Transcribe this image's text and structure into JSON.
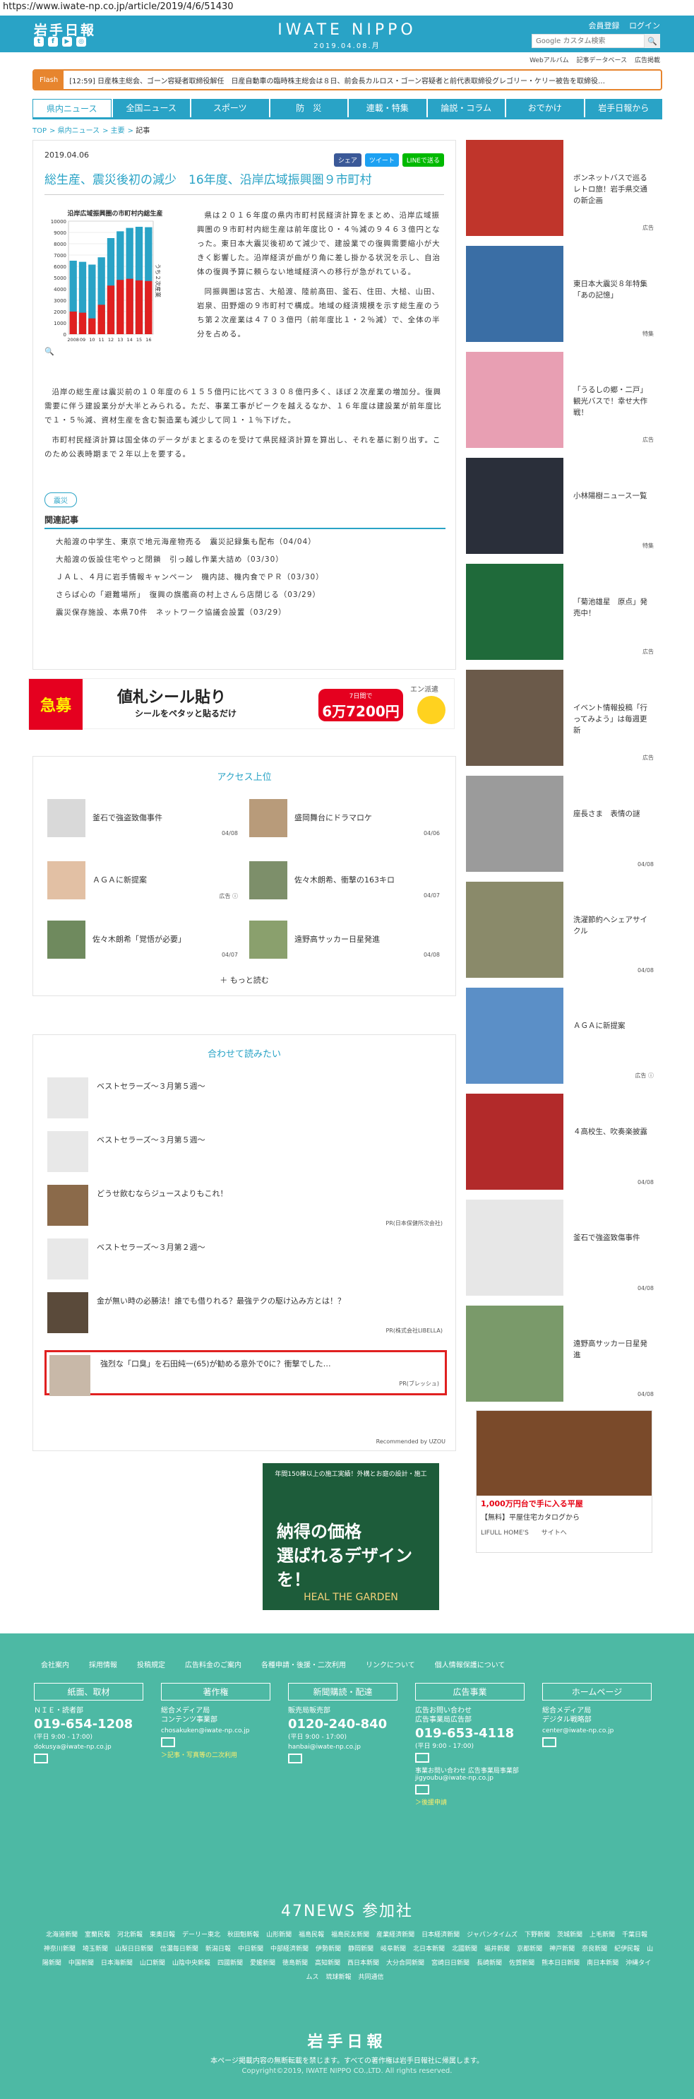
{
  "url": "https://www.iwate-np.co.jp/article/2019/4/6/51430",
  "header": {
    "logo": "岩手日報",
    "site_name": "IWATE NIPPO",
    "date": "2019.04.08.月",
    "member": "会員登録",
    "login": "ログイン",
    "search_placeholder": "Google カスタム検索",
    "social_icons": [
      "twitter-icon",
      "facebook-icon",
      "youtube-icon",
      "instagram-icon"
    ]
  },
  "subnav": [
    "Webアルバム",
    "記事データベース",
    "広告掲載"
  ],
  "flash": {
    "tag": "Flash",
    "text": "[12:59] 日産株主総会、ゴーン容疑者取締役解任　日産自動車の臨時株主総会は８日、前会長カルロス・ゴーン容疑者と前代表取締役グレゴリー・ケリー被告を取締役…"
  },
  "gnav": [
    "県内ニュース",
    "全国ニュース",
    "スポーツ",
    "防　災",
    "連載・特集",
    "論説・コラム",
    "おでかけ",
    "岩手日報から"
  ],
  "breadcrumb": [
    "TOP",
    "県内ニュース",
    "主要",
    "記事"
  ],
  "article": {
    "date": "2019.04.06",
    "share": [
      "シェア",
      "ツイート",
      "LINEで送る"
    ],
    "title": "総生産、震災後初の減少　16年度、沿岸広域振興圏９市町村",
    "p1": "県は２０１６年度の県内市町村民経済計算をまとめ、沿岸広域振興圏の９市町村内総生産は前年度比０・４％減の９４６３億円となった。東日本大震災後初めて減少で、建設業での復興需要縮小が大きく影響した。沿岸経済が曲がり角に差し掛かる状況を示し、自治体の復興予算に頼らない地域経済への移行が急がれている。",
    "p2": "同振興圏は宮古、大船渡、陸前高田、釜石、住田、大槌、山田、岩泉、田野畑の９市町村で構成。地域の経済規模を示す総生産のうち第２次産業は４７０３億円（前年度比１・２％減）で、全体の半分を占める。",
    "p3": "沿岸の総生産は震災前の１０年度の６１５５億円に比べて３３０８億円多く、ほぼ２次産業の増加分。復興需要に伴う建設業分が大半とみられる。ただ、事業工事がピークを越えるなか、１６年度は建設業が前年度比で１・５％減、資材生産を含む製造業も減少して同１・１％下げた。",
    "p4": "市町村民経済計算は国全体のデータがまとまるのを受けて県民経済計算を算出し、それを基に割り出す。このため公表時期まで２年以上を要する。",
    "tag": "震災",
    "related_title": "関連記事",
    "related": [
      "大船渡の中学生、東京で地元海産物売る　震災記録集も配布（04/04）",
      "大船渡の仮設住宅やっと閉鎖　引っ越し作業大詰め（03/30）",
      "ＪＡＬ、４月に岩手情報キャンペーン　機内誌、機内食でＰＲ（03/30）",
      "さらば心の「避難場所」　復興の旗艦商の村上さんら店閉じる（03/29）",
      "震災保存施設、本県70件　ネットワーク協議会設置（03/29）"
    ]
  },
  "chart_data": {
    "type": "bar",
    "title": "沿岸広域振興圏の市町村内総生産",
    "categories": [
      "2008",
      "09",
      "10",
      "11",
      "12",
      "13",
      "14",
      "15",
      "16"
    ],
    "ylim": [
      0,
      10000
    ],
    "yticks": [
      "0",
      "1000",
      "2000",
      "3000",
      "4000",
      "5000",
      "6000",
      "7000",
      "8000",
      "9000",
      "10000"
    ],
    "series": [
      {
        "name": "総生産",
        "values": [
          6500,
          6400,
          6155,
          6800,
          8500,
          9100,
          9400,
          9500,
          9463
        ]
      },
      {
        "name": "うち２次産業",
        "values": [
          2000,
          1900,
          1395,
          2600,
          4300,
          4800,
          4900,
          4760,
          4703
        ]
      }
    ],
    "annotation": "うち２次産業",
    "colors": [
      "#29a3c6",
      "#e02020"
    ]
  },
  "ad1": {
    "badge": "急募",
    "headline": "値札シール貼り",
    "sub": "シールをペタッと貼るだけ",
    "price_top": "7日間で",
    "price": "6万7200円",
    "brand": "エン派遣"
  },
  "access": {
    "title": "アクセス上位",
    "items": [
      {
        "title": "釜石で強盗致傷事件",
        "date": "04/08"
      },
      {
        "title": "盛岡舞台にドラマロケ",
        "date": "04/06"
      },
      {
        "title": "ＡＧＡに新提案",
        "date": "広告 ⓘ"
      },
      {
        "title": "佐々木朗希、衝撃の163キロ",
        "date": "04/07"
      },
      {
        "title": "佐々木朗希「覚悟が必要」",
        "date": "04/07"
      },
      {
        "title": "遠野高サッカー日星発進",
        "date": "04/08"
      }
    ],
    "more": "＋ もっと読む"
  },
  "recommend": {
    "title": "合わせて読みたい",
    "items": [
      {
        "title": "ベストセラーズ～３月第５週～",
        "pr": ""
      },
      {
        "title": "ベストセラーズ～３月第５週～",
        "pr": ""
      },
      {
        "title": "どうせ飲むならジュースよりもこれ！",
        "pr": "PR(日本保健所次会社)"
      },
      {
        "title": "ベストセラーズ～３月第２週～",
        "pr": ""
      },
      {
        "title": "金が無い時の必勝法！誰でも借りれる？最強テクの駆け込み方とは！？",
        "pr": "PR(株式会社LIBELLA)"
      },
      {
        "title": "強烈な「口臭」を石田純一(65)が勧める意外で0に？衝撃でした…",
        "pr": "PR(ブレッシュ)"
      }
    ],
    "by": "Recommended by UZOU"
  },
  "ad2": {
    "top": "年間150棟以上の施工実績！外構とお庭の設計・施工",
    "main": "納得の価格\n選ばれるデザインを！",
    "brand": "HEAL THE GARDEN"
  },
  "sidebar": [
    {
      "title": "ボンネットバスで巡るレトロ旅！岩手県交通の新企画",
      "date": "広告"
    },
    {
      "title": "東日本大震災８年特集「あの記憶」",
      "date": "特集"
    },
    {
      "title": "「うるしの郷・二戸」観光バスで！幸せ大作戦！",
      "date": "広告"
    },
    {
      "title": "小林陽樹ニュース一覧",
      "date": "特集"
    },
    {
      "title": "「菊池雄星　原点」発売中！",
      "date": "広告"
    },
    {
      "title": "イベント情報投稿「行ってみよう」は毎週更新",
      "date": "広告"
    },
    {
      "title": "座長さま　表情の謎",
      "date": "04/08"
    },
    {
      "title": "洗濯節約へシェアサイクル",
      "date": "04/08"
    },
    {
      "title": "ＡＧＡに新提案",
      "date": "広告 ⓘ"
    },
    {
      "title": "４高校生、吹奏楽披露",
      "date": "04/08"
    },
    {
      "title": "釜石で強盗致傷事件",
      "date": "04/08"
    },
    {
      "title": "遠野高サッカー日星発進",
      "date": "04/08"
    }
  ],
  "adSide": {
    "t1": "1,000万円台で手に入る平屋",
    "t2": "【無料】平屋住宅カタログから",
    "t3": "LIFULL HOME'S　　サイトへ"
  },
  "footer": {
    "nav": [
      "会社案内",
      "採用情報",
      "投稿規定",
      "広告料金のご案内",
      "各種申請・後援・二次利用",
      "リンクについて",
      "個人情報保護について"
    ],
    "cols": [
      {
        "head": "紙面、取材",
        "name": "ＮＩＥ・読者部",
        "tel": "019-654-1208",
        "hours": "(平日 9:00 - 17:00)",
        "mail": "dokusya@iwate-np.co.jp",
        "link": ""
      },
      {
        "head": "著作権",
        "name": "総合メディア局\nコンテンツ事業部",
        "tel": "",
        "hours": "",
        "mail": "chosakuken@iwate-np.co.jp",
        "link": "＞記事・写真等の二次利用"
      },
      {
        "head": "新聞購読・配達",
        "name": "販売局販売部",
        "tel": "0120-240-840",
        "hours": "(平日 9:00 - 17:00)",
        "mail": "hanbai@iwate-np.co.jp",
        "link": ""
      },
      {
        "head": "広告事業",
        "name": "広告お問い合わせ\n広告事業局広告部",
        "tel": "019-653-4118",
        "hours": "(平日 9:00 - 17:00)",
        "mail": "事業お問い合わせ 広告事業局事業部 jigyoubu@iwate-np.co.jp",
        "link": "＞後援申請"
      },
      {
        "head": "ホームページ",
        "name": "総合メディア局\nデジタル戦略部",
        "tel": "",
        "hours": "",
        "mail": "center@iwate-np.co.jp",
        "link": ""
      }
    ],
    "n47": "47NEWS 参加社",
    "papers": [
      "北海道新聞",
      "室蘭民報",
      "河北新報",
      "東奥日報",
      "デーリー東北",
      "秋田魁新報",
      "山形新聞",
      "福島民報",
      "福島民友新聞",
      "産業経済新聞",
      "日本経済新聞",
      "ジャパンタイムズ",
      "下野新聞",
      "茨城新聞",
      "上毛新聞",
      "千葉日報",
      "神奈川新聞",
      "埼玉新聞",
      "山梨日日新聞",
      "信濃毎日新聞",
      "新潟日報",
      "中日新聞",
      "中部経済新聞",
      "伊勢新聞",
      "静岡新聞",
      "岐阜新聞",
      "北日本新聞",
      "北國新聞",
      "福井新聞",
      "京都新聞",
      "神戸新聞",
      "奈良新聞",
      "紀伊民報",
      "山陽新聞",
      "中国新聞",
      "日本海新聞",
      "山口新聞",
      "山陰中央新報",
      "四國新聞",
      "愛媛新聞",
      "徳島新聞",
      "高知新聞",
      "西日本新聞",
      "大分合同新聞",
      "宮崎日日新聞",
      "長崎新聞",
      "佐賀新聞",
      "熊本日日新聞",
      "南日本新聞",
      "沖縄タイムス",
      "琉球新報",
      "共同通信"
    ],
    "logo": "岩手日報",
    "note": "本ページ掲載内容の無断転載を禁じます。すべての著作権は岩手日報社に帰属します。",
    "copy": "Copyright©2019, IWATE NIPPO CO.,LTD. All rights reserved."
  }
}
